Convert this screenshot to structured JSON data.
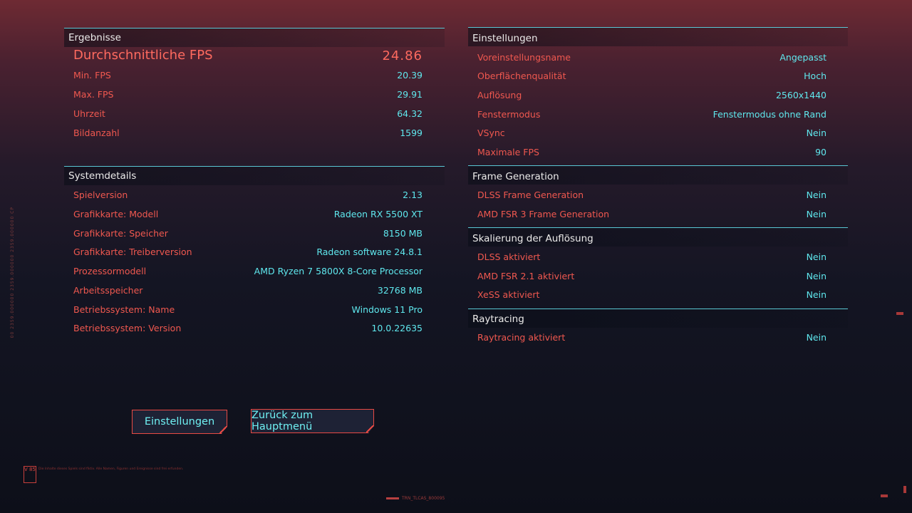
{
  "results": {
    "title": "Ergebnisse",
    "avg_label": "Durchschnittliche FPS",
    "avg_value": "24.86",
    "rows": [
      {
        "label": "Min. FPS",
        "value": "20.39"
      },
      {
        "label": "Max. FPS",
        "value": "29.91"
      },
      {
        "label": "Uhrzeit",
        "value": "64.32"
      },
      {
        "label": "Bildanzahl",
        "value": "1599"
      }
    ]
  },
  "system": {
    "title": "Systemdetails",
    "rows": [
      {
        "label": "Spielversion",
        "value": "2.13"
      },
      {
        "label": "Grafikkarte: Modell",
        "value": "Radeon RX 5500 XT"
      },
      {
        "label": "Grafikkarte: Speicher",
        "value": "8150 MB"
      },
      {
        "label": "Grafikkarte: Treiberversion",
        "value": "Radeon software 24.8.1"
      },
      {
        "label": "Prozessormodell",
        "value": "AMD Ryzen 7 5800X 8-Core Processor"
      },
      {
        "label": "Arbeitsspeicher",
        "value": "32768 MB"
      },
      {
        "label": "Betriebssystem: Name",
        "value": "Windows 11 Pro"
      },
      {
        "label": "Betriebssystem: Version",
        "value": "10.0.22635"
      }
    ]
  },
  "settings": {
    "title": "Einstellungen",
    "rows": [
      {
        "label": "Voreinstellungsname",
        "value": "Angepasst"
      },
      {
        "label": "Oberflächenqualität",
        "value": "Hoch"
      },
      {
        "label": "Auflösung",
        "value": "2560x1440"
      },
      {
        "label": "Fenstermodus",
        "value": "Fenstermodus ohne Rand"
      },
      {
        "label": "VSync",
        "value": "Nein"
      },
      {
        "label": "Maximale FPS",
        "value": "90"
      }
    ]
  },
  "framegen": {
    "title": "Frame Generation",
    "rows": [
      {
        "label": "DLSS Frame Generation",
        "value": "Nein"
      },
      {
        "label": "AMD FSR 3 Frame Generation",
        "value": "Nein"
      }
    ]
  },
  "scaling": {
    "title": "Skalierung der Auflösung",
    "rows": [
      {
        "label": "DLSS aktiviert",
        "value": "Nein"
      },
      {
        "label": "AMD FSR 2.1 aktiviert",
        "value": "Nein"
      },
      {
        "label": "XeSS aktiviert",
        "value": "Nein"
      }
    ]
  },
  "raytracing": {
    "title": "Raytracing",
    "rows": [
      {
        "label": "Raytracing aktiviert",
        "value": "Nein"
      }
    ]
  },
  "buttons": {
    "settings": "Einstellungen",
    "main_menu": "Zurück zum Hauptmenü"
  },
  "footer": {
    "logo": "V 85",
    "tag": "TRN_TLCAS_800095",
    "side": "00 2359.000000 2359.000000 2359.000000 CP",
    "fine": "Die Inhalte dieses Spiels sind fiktiv. Alle Namen, Figuren und Ereignisse sind frei erfunden."
  },
  "colors": {
    "label": "#f0584f",
    "value": "#5fe8ee",
    "accent_line": "#59c7d4",
    "button_border": "#e84a44"
  }
}
